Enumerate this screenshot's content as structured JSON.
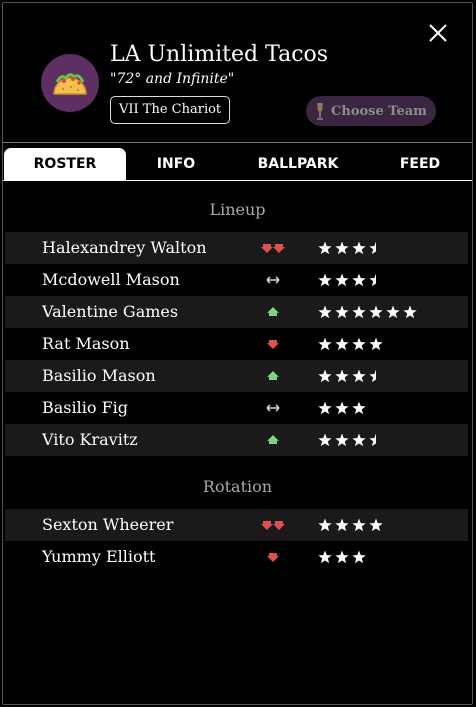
{
  "team": {
    "name": "LA Unlimited Tacos",
    "slogan": "\"72° and Infinite\"",
    "tarot": "VII The Chariot",
    "choose_label": "Choose Team",
    "logo_icon": "taco-icon",
    "logo_bg": "#5d2f63"
  },
  "tabs": [
    {
      "label": "ROSTER",
      "active": true
    },
    {
      "label": "INFO",
      "active": false
    },
    {
      "label": "BALLPARK",
      "active": false
    },
    {
      "label": "FEED",
      "active": false
    }
  ],
  "colors": {
    "trend_down": "#e05050",
    "trend_up": "#7fd37f",
    "trend_flat": "#cccccc",
    "section_title": "#a9a9a9"
  },
  "lineup": {
    "title": "Lineup",
    "players": [
      {
        "name": "Halexandrey Walton",
        "trend": "down-double",
        "stars": 3.5
      },
      {
        "name": "Mcdowell Mason",
        "trend": "flat",
        "stars": 3.5
      },
      {
        "name": "Valentine Games",
        "trend": "up",
        "stars": 6
      },
      {
        "name": "Rat Mason",
        "trend": "down",
        "stars": 4
      },
      {
        "name": "Basilio Mason",
        "trend": "up",
        "stars": 3.5
      },
      {
        "name": "Basilio Fig",
        "trend": "flat",
        "stars": 3
      },
      {
        "name": "Vito Kravitz",
        "trend": "up",
        "stars": 3.5
      }
    ]
  },
  "rotation": {
    "title": "Rotation",
    "players": [
      {
        "name": "Sexton Wheerer",
        "trend": "down-double",
        "stars": 4
      },
      {
        "name": "Yummy Elliott",
        "trend": "down",
        "stars": 3
      }
    ]
  }
}
